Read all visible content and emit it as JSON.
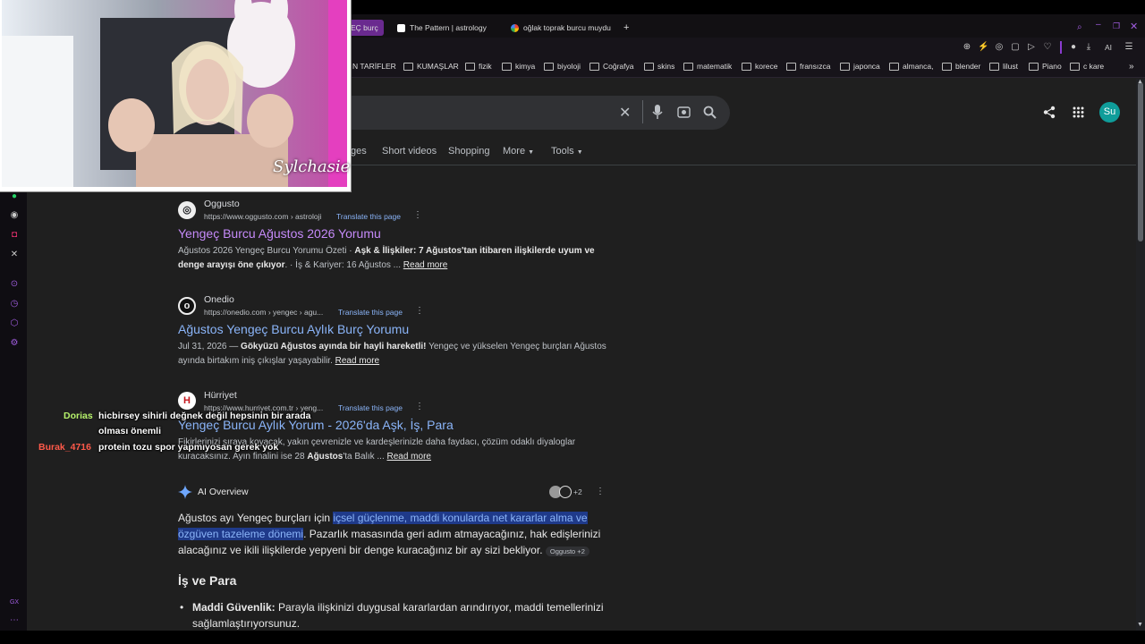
{
  "browser": {
    "tabs": [
      {
        "label": "EÇ burç",
        "active": true
      },
      {
        "label": "The Pattern | astrology",
        "active": false
      },
      {
        "label": "oğlak toprak burcu muydu",
        "active": false
      }
    ],
    "new_tab_label": "+",
    "toolbar_ai_label": "AI",
    "bookmarks": [
      "N TARİFLER",
      "KUMAŞLAR",
      "fizik",
      "kimya",
      "biyoloji",
      "Coğrafya",
      "skins",
      "matematik",
      "korece",
      "fransızca",
      "japonca",
      "almanca,",
      "blender",
      "lilust",
      "Piano",
      "c kare"
    ],
    "accent_color": "#8a3bd0"
  },
  "google": {
    "avatar_initials": "Su",
    "nav_tabs": [
      "ges",
      "Short videos",
      "Shopping",
      "More",
      "Tools"
    ],
    "results": [
      {
        "site": "Oggusto",
        "url": "https://www.oggusto.com › astroloji",
        "translate": "Translate this page",
        "title": "Yengeç Burcu Ağustos 2026 Yorumu",
        "snippet_pre": "Ağustos 2026 Yengeç Burcu Yorumu Özeti · ",
        "snippet_bold": "Aşk & İlişkiler: 7 Ağustos'tan itibaren ilişkilerde uyum ve denge arayışı öne çıkıyor",
        "snippet_post": ". · İş & Kariyer: 16 Ağustos ...",
        "read_more": "Read more"
      },
      {
        "site": "Onedio",
        "url": "https://onedio.com › yengec › agu...",
        "translate": "Translate this page",
        "title": "Ağustos Yengeç Burcu Aylık Burç Yorumu",
        "snippet_pre": "Jul 31, 2026 — ",
        "snippet_bold": "Gökyüzü Ağustos ayında bir hayli hareketli!",
        "snippet_post": " Yengeç ve yükselen Yengeç burçları Ağustos ayında birtakım iniş çıkışlar yaşayabilir.",
        "read_more": "Read more"
      },
      {
        "site": "Hürriyet",
        "url": "https://www.hurriyet.com.tr › yeng...",
        "translate": "Translate this page",
        "title": "Yengeç Burcu Aylık Yorum - 2026'da Aşk, İş, Para",
        "snippet_pre": "Fikirlerinizi sıraya koyacak, yakın çevrenizle ve kardeşlerinizle daha faydacı, çözüm odaklı diyaloglar kuracaksınız. Ayın finalini ise 28 ",
        "snippet_bold": "Ağustos",
        "snippet_post": "'ta Balık ...",
        "read_more": "Read more"
      }
    ],
    "ai_overview": {
      "label": "AI Overview",
      "sources_count": "+2",
      "text_pre": "Ağustos ayı Yengeç burçları için ",
      "text_highlight": "içsel güçlenme, maddi konularda net kararlar alma ve özgüven tazeleme dönemi",
      "text_post": ". Pazarlık masasında geri adım atmayacağınız, hak edişlerinizi alacağınız ve ikili ilişkilerde yepyeni bir denge kuracağınız bir ay sizi bekliyor.",
      "chip": "Oggusto +2",
      "section_heading": "İş ve Para",
      "bullet_bold": "Maddi Güvenlik:",
      "bullet_text": " Parayla ilişkinizi duygusal kararlardan arındırıyor, maddi temellerinizi sağlamlaştırıyorsunuz."
    }
  },
  "stream": {
    "watermark": "Sylchasie",
    "chat": [
      {
        "user": "Dorias",
        "color": "#b6f26b",
        "message": "hicbirsey sihirli değnek değil hepsinin bir arada"
      },
      {
        "user": "",
        "color": "#ffffff",
        "message": "olması önemli"
      },
      {
        "user": "Burak_4716",
        "color": "#ff5a4a",
        "message": "protein tozu spor yapmıyosan gerek yok"
      }
    ]
  }
}
